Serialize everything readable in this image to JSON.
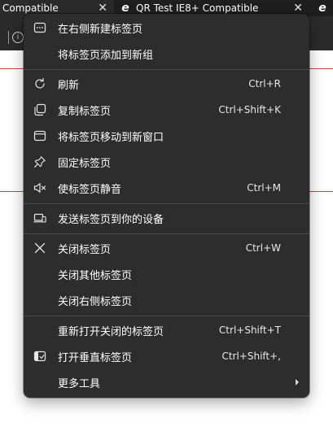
{
  "tabs": [
    {
      "title": "Compatible",
      "close_glyph": "✕"
    },
    {
      "title": "QR Test IE8+ Compatible",
      "close_glyph": "✕",
      "favicon": "edge-icon"
    },
    {
      "title": "",
      "favicon": "edge-icon"
    }
  ],
  "toolbar": {
    "info_glyph": "i"
  },
  "menu": {
    "items": [
      {
        "label": "在右侧新建标签页",
        "shortcut": "",
        "icon": "new-tab-right-icon"
      },
      {
        "label": "将标签页添加到新组",
        "shortcut": "",
        "icon": ""
      },
      {
        "label": "刷新",
        "shortcut": "Ctrl+R",
        "icon": "refresh-icon"
      },
      {
        "label": "复制标签页",
        "shortcut": "Ctrl+Shift+K",
        "icon": "duplicate-tab-icon"
      },
      {
        "label": "将标签页移动到新窗口",
        "shortcut": "",
        "icon": "new-window-icon"
      },
      {
        "label": "固定标签页",
        "shortcut": "",
        "icon": "pin-icon"
      },
      {
        "label": "使标签页静音",
        "shortcut": "Ctrl+M",
        "icon": "mute-icon"
      },
      {
        "label": "发送标签页到你的设备",
        "shortcut": "",
        "icon": "send-to-devices-icon"
      },
      {
        "label": "关闭标签页",
        "shortcut": "Ctrl+W",
        "icon": "close-icon"
      },
      {
        "label": "关闭其他标签页",
        "shortcut": "",
        "icon": ""
      },
      {
        "label": "关闭右侧标签页",
        "shortcut": "",
        "icon": ""
      },
      {
        "label": "重新打开关闭的标签页",
        "shortcut": "Ctrl+Shift+T",
        "icon": ""
      },
      {
        "label": "打开垂直标签页",
        "shortcut": "Ctrl+Shift+,",
        "icon": "vertical-tabs-icon"
      },
      {
        "label": "更多工具",
        "shortcut": "",
        "icon": "",
        "has_submenu": true
      }
    ]
  },
  "colors": {
    "menu_bg": "#2d2d2d",
    "separator": "#4a4a4a",
    "text": "#ffffff",
    "page_line": "#d93b3b"
  }
}
